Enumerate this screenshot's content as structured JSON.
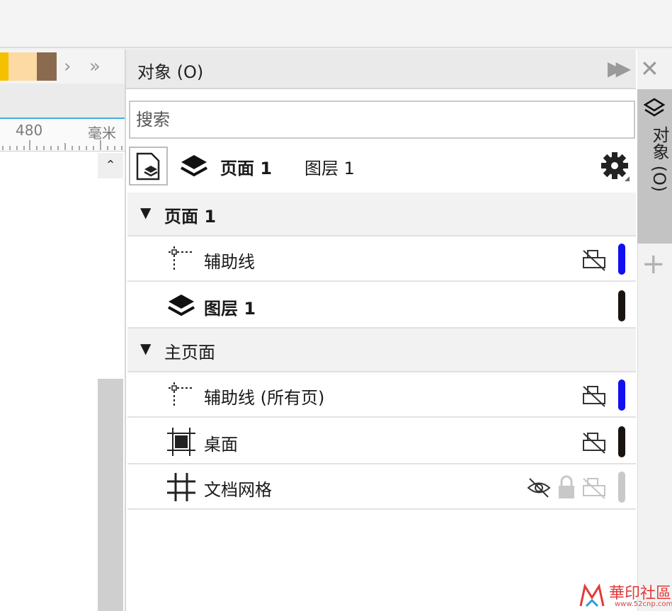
{
  "canvas": {
    "ruler": {
      "mark": "480",
      "unit": "毫米"
    }
  },
  "docker": {
    "title": "对象 (O)",
    "search": {
      "placeholder": "搜索",
      "value": ""
    },
    "current": {
      "page": "页面 1",
      "layer": "图层 1"
    },
    "sections": [
      {
        "label": "页面 1",
        "rows": [
          {
            "label": "辅助线",
            "icon": "guides-icon",
            "color": "#1010f0"
          },
          {
            "label": "图层 1",
            "icon": "layer-icon",
            "color": "#1a1410"
          }
        ]
      },
      {
        "label": "主页面",
        "rows": [
          {
            "label": "辅助线 (所有页)",
            "icon": "guides-icon",
            "color": "#1010f0"
          },
          {
            "label": "桌面",
            "icon": "desktop-icon",
            "color": "#1a1410"
          },
          {
            "label": "文档网格",
            "icon": "grid-icon",
            "color": "#c8c8c8"
          }
        ]
      }
    ]
  },
  "sidetab": {
    "label": "对象 (O)"
  },
  "watermark": {
    "main": "華印社區",
    "sub": "www.52cnp.com"
  }
}
